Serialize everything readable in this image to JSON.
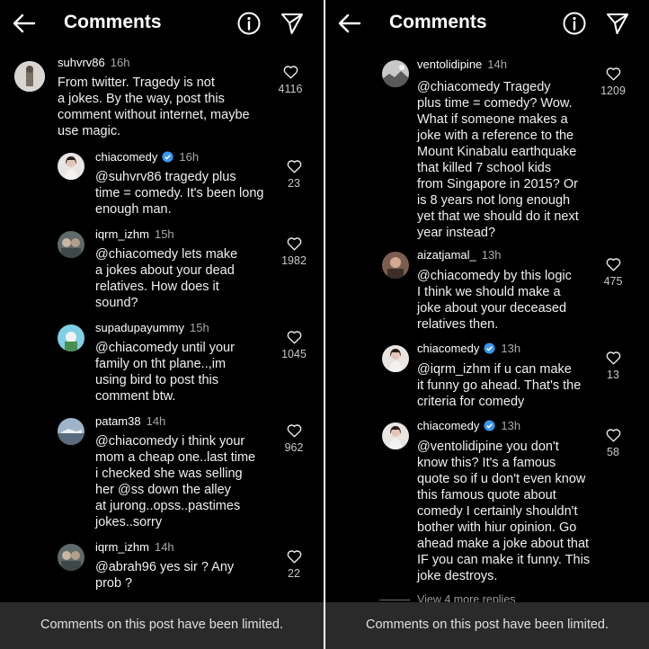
{
  "left": {
    "header": {
      "title": "Comments"
    },
    "comments": [
      {
        "user": "suhvrv86",
        "time": "16h",
        "verified": false,
        "text": "From twitter. Tragedy is not\na jokes. By the way, post this\ncomment without internet, maybe\nuse magic.",
        "likes": "4116"
      },
      {
        "user": "chiacomedy",
        "time": "16h",
        "verified": true,
        "text": "@suhvrv86 tragedy plus\ntime = comedy. It's been long\nenough man.",
        "likes": "23"
      },
      {
        "user": "iqrm_izhm",
        "time": "15h",
        "verified": false,
        "text": "@chiacomedy lets make\na jokes about your dead\nrelatives. How does it\nsound?",
        "likes": "1982"
      },
      {
        "user": "supadupayummy",
        "time": "15h",
        "verified": false,
        "text": "@chiacomedy until your\nfamily on tht plane..,im\nusing bird to post this\ncomment btw.",
        "likes": "1045"
      },
      {
        "user": "patam38",
        "time": "14h",
        "verified": false,
        "text": "@chiacomedy i think your\nmom a cheap one..last time\ni checked she was selling\nher @ss down the alley\nat jurong..opss..pastimes\njokes..sorry",
        "likes": "962"
      },
      {
        "user": "iqrm_izhm",
        "time": "14h",
        "verified": false,
        "text": "@abrah96 yes sir ? Any\nprob ?",
        "likes": "22"
      }
    ],
    "footer": "Comments on this post have been limited."
  },
  "right": {
    "header": {
      "title": "Comments"
    },
    "comments": [
      {
        "user": "ventolidipine",
        "time": "14h",
        "verified": false,
        "text": "@chiacomedy Tragedy\nplus time = comedy? Wow.\nWhat if someone makes a\njoke with a reference to the\nMount Kinabalu earthquake\nthat killed 7 school kids\nfrom Singapore in 2015? Or\nis 8 years not long enough\nyet that we should do it next\nyear instead?",
        "likes": "1209"
      },
      {
        "user": "aizatjamal_",
        "time": "13h",
        "verified": false,
        "text": "@chiacomedy by this logic\nI think we should make a\njoke about your deceased\nrelatives then.",
        "likes": "475"
      },
      {
        "user": "chiacomedy",
        "time": "13h",
        "verified": true,
        "text": "@iqrm_izhm if u can make\nit funny go ahead. That's the\ncriteria for comedy",
        "likes": "13"
      },
      {
        "user": "chiacomedy",
        "time": "13h",
        "verified": true,
        "text": "@ventolidipine you don't\nknow this? It's a  famous\nquote so if u don't even know\nthis famous quote about\ncomedy I certainly shouldn't\nbother with hiur opinion. Go\nahead make a joke about that\nIF you can make it funny. This\njoke destroys.",
        "likes": "58"
      }
    ],
    "view_more": "View 4 more replies",
    "footer": "Comments on this post have been limited."
  },
  "icons": {
    "back": "arrow-left-icon",
    "info": "info-icon",
    "share": "send-icon",
    "like": "heart-icon",
    "verified": "verified-badge-icon"
  },
  "colors": {
    "background": "#000000",
    "footer": "#2a2a2a",
    "verified": "#3897f0",
    "muted_text": "#a8a8a8"
  }
}
